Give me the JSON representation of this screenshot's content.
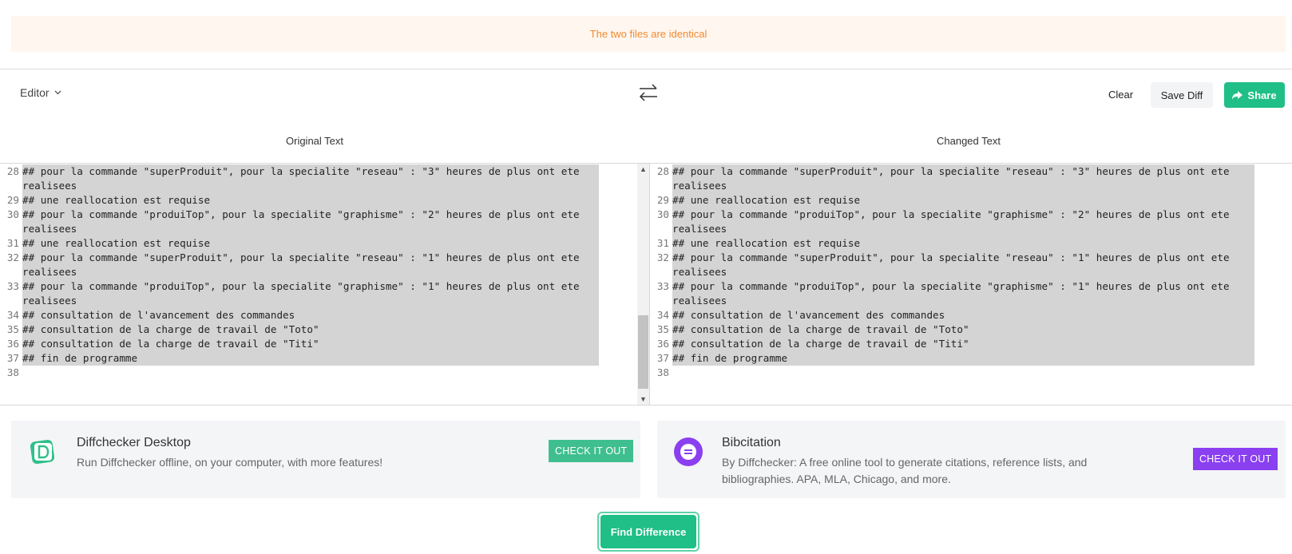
{
  "notice": {
    "text": "The two files are identical"
  },
  "toolbar": {
    "editor_label": "Editor",
    "clear_label": "Clear",
    "save_label": "Save Diff",
    "share_label": "Share"
  },
  "panes": {
    "original_title": "Original Text",
    "changed_title": "Changed Text",
    "lines": [
      {
        "n": "28",
        "text": "## pour la commande \"superProduit\", pour la specialite \"reseau\" : \"3\" heures de plus ont ete",
        "hl": true
      },
      {
        "n": "",
        "text": "realisees",
        "hl": true
      },
      {
        "n": "29",
        "text": "## une reallocation est requise",
        "hl": true
      },
      {
        "n": "30",
        "text": "## pour la commande \"produiTop\", pour la specialite \"graphisme\" : \"2\" heures de plus ont ete",
        "hl": true
      },
      {
        "n": "",
        "text": "realisees",
        "hl": true
      },
      {
        "n": "31",
        "text": "## une reallocation est requise",
        "hl": true
      },
      {
        "n": "32",
        "text": "## pour la commande \"superProduit\", pour la specialite \"reseau\" : \"1\" heures de plus ont ete",
        "hl": true
      },
      {
        "n": "",
        "text": "realisees",
        "hl": true
      },
      {
        "n": "33",
        "text": "## pour la commande \"produiTop\", pour la specialite \"graphisme\" : \"1\" heures de plus ont ete",
        "hl": true
      },
      {
        "n": "",
        "text": "realisees",
        "hl": true
      },
      {
        "n": "34",
        "text": "## consultation de l'avancement des commandes",
        "hl": true
      },
      {
        "n": "35",
        "text": "## consultation de la charge de travail de \"Toto\"",
        "hl": true
      },
      {
        "n": "36",
        "text": "## consultation de la charge de travail de \"Titi\"",
        "hl": true
      },
      {
        "n": "37",
        "text": "## fin de programme",
        "hl": true
      },
      {
        "n": "38",
        "text": "",
        "hl": false
      }
    ]
  },
  "promo": {
    "desktop": {
      "title": "Diffchecker Desktop",
      "desc": "Run Diffchecker offline, on your computer, with more features!",
      "button": "CHECK IT OUT",
      "color": "#3fbf8f"
    },
    "bib": {
      "title": "Bibcitation",
      "desc": "By Diffchecker: A free online tool to generate citations, reference lists, and bibliographies. APA, MLA, Chicago, and more.",
      "button": "CHECK IT OUT",
      "color": "#8a3ff0"
    }
  },
  "actions": {
    "find_label": "Find Difference"
  },
  "colors": {
    "accent": "#1fbf87",
    "notice_bg": "#fff6ef",
    "notice_text": "#f28a2e",
    "highlight": "#d4d4d4"
  }
}
